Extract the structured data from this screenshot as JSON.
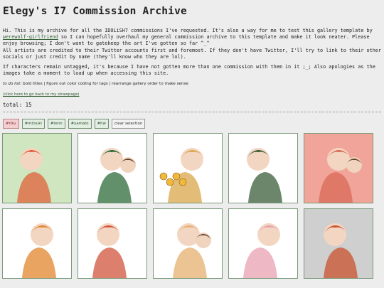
{
  "page": {
    "title": "Elegy's I7 Commission Archive",
    "intro_1_before": "Hi. This is my archive for all the IDOLiSH7 commissions I've requested. It's also a way for me to test this gallery template by ",
    "intro_1_link": "werewolf-girlfriend",
    "intro_1_after": " so I can hopefully overhaul my general commission archive to this template and make it look neater. Please enjoy browsing; I don't want to gatekeep the art I've gotten so far ^_^",
    "intro_2": "All artists are credited to their Twitter accounts first and foremost. If they don't have Twitter, I'll try to link to their other socials or just credit by name (they'll know who they are lol).",
    "intro_3": "If characters remain untagged, it's because I have not gotten more than one commission with them in it ;_; Also apologies as the images take a moment to load up when accessing this site.",
    "todo_label": "to do list:",
    "todo_text": " bold titles | figure out color coding for tags | rearrange gallery order to make sense",
    "back_link": "(click here to go back to my strawpage)",
    "total": "total: 15"
  },
  "filters": [
    {
      "label": "#riku",
      "active": true
    },
    {
      "label": "#mitsuki",
      "active": false
    },
    {
      "label": "#tenn",
      "active": false
    },
    {
      "label": "#yamato",
      "active": false
    },
    {
      "label": "#hw",
      "active": false
    },
    {
      "label": "clear selection",
      "active": false,
      "clear": true
    }
  ],
  "gallery": [
    {
      "icon": "redhead-boy-harmonica-art",
      "bg": "#cfe6c0",
      "accent": "#e0613a"
    },
    {
      "icon": "group-idols-art",
      "bg": "#ffffff",
      "accent": "#2e6b3a"
    },
    {
      "icon": "sunflowers-duo-art",
      "bg": "#ffffff",
      "accent": "#d9a64a"
    },
    {
      "icon": "group-dance-art",
      "bg": "#ffffff",
      "accent": "#3b5e3a"
    },
    {
      "icon": "redhead-guitar-art",
      "bg": "#f1a59a",
      "accent": "#d96a55"
    },
    {
      "icon": "redhead-jacket-art",
      "bg": "#ffffff",
      "accent": "#e2852e"
    },
    {
      "icon": "duo-lounging-art",
      "bg": "#ffffff",
      "accent": "#d2543c"
    },
    {
      "icon": "duo-hug-art",
      "bg": "#ffffff",
      "accent": "#e6b070"
    },
    {
      "icon": "duo-ribbons-art",
      "bg": "#ffffff",
      "accent": "#e8a0b0"
    },
    {
      "icon": "redhead-portrait-art",
      "bg": "#cfcfcf",
      "accent": "#c9522e"
    }
  ]
}
